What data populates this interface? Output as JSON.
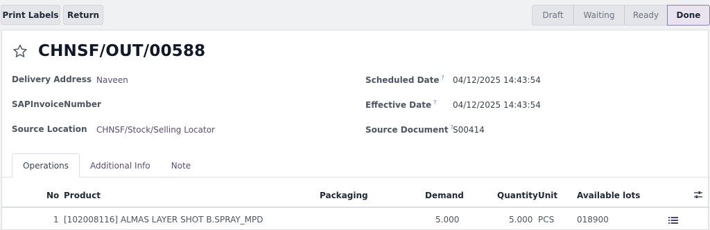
{
  "toolbar": {
    "print_labels": "Print Labels",
    "return": "Return"
  },
  "statusbar": {
    "steps": [
      "Draft",
      "Waiting",
      "Ready",
      "Done"
    ],
    "active": "Done"
  },
  "record": {
    "favorite_icon": "star-outline-icon",
    "title": "CHNSF/OUT/00588",
    "fields_left": [
      {
        "label": "Delivery Address",
        "value": "Naveen"
      },
      {
        "label": "SAPInvoiceNumber",
        "value": ""
      },
      {
        "label": "Source Location",
        "value": "CHNSF/Stock/Selling Locator"
      }
    ],
    "fields_right": [
      {
        "label": "Scheduled Date",
        "help": "?",
        "value": "04/12/2025 14:43:54"
      },
      {
        "label": "Effective Date",
        "help": "?",
        "value": "04/12/2025 14:43:54"
      },
      {
        "label": "Source Document",
        "help": "?",
        "value": "S00414"
      }
    ]
  },
  "tabs": [
    "Operations",
    "Additional Info",
    "Note"
  ],
  "table": {
    "headers": [
      "No",
      "Product",
      "Packaging",
      "Demand",
      "Quantity",
      "Unit",
      "Available lots"
    ],
    "rows": [
      {
        "no": "1",
        "product": "[102008116] ALMAS LAYER SHOT B.SPRAY_MPD",
        "packaging": "",
        "demand": "5.000",
        "quantity": "5.000",
        "unit": "PCS",
        "lots": "018900"
      }
    ]
  }
}
